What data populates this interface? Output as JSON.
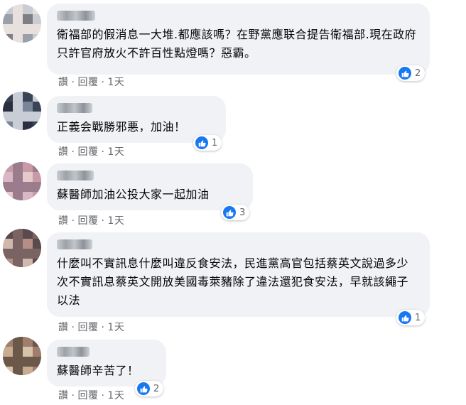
{
  "comments": [
    {
      "text": "衛福部的假消息一大堆.都應該嗎？在野黨應联合提告衛福部.現在政府只許官府放火不許百性點燈嗎？惡霸。",
      "like": "讚",
      "reply": "回覆",
      "time": "1天",
      "reactions": "2",
      "colors": [
        "#c9ccd2",
        "#7d7f85",
        "#e8e0dc",
        "#9aa0aa"
      ]
    },
    {
      "text": "正義会戰勝邪悪，加油！",
      "like": "讚",
      "reply": "回覆",
      "time": "1天",
      "reactions": "1",
      "colors": [
        "#3b4457",
        "#7b8598",
        "#c9cdd6",
        "#2b3040"
      ]
    },
    {
      "text": "蘇醫師加油公投大家一起加油",
      "like": "讚",
      "reply": "回覆",
      "time": "1天",
      "reactions": "3",
      "colors": [
        "#c79aa6",
        "#e6c9c9",
        "#9a7c8c",
        "#d9b7c4"
      ]
    },
    {
      "text": "什麼叫不實訊息什麼叫違反食安法，民進黨高官包括蔡英文說過多少次不實訊息蔡英文開放美國毒萊豬除了違法還犯食安法，早就該繩子以法",
      "like": "讚",
      "reply": "回覆",
      "time": "1天",
      "reactions": "1",
      "colors": [
        "#5a4a4d",
        "#b58e86",
        "#7a6463",
        "#d2b7ad"
      ]
    },
    {
      "text": "蘇醫師辛苦了！",
      "like": "讚",
      "reply": "回覆",
      "time": "1天",
      "reactions": "2",
      "colors": [
        "#a07e6c",
        "#d8c2aa",
        "#6b5848",
        "#c8ad92"
      ]
    }
  ],
  "accent": "#1877f2",
  "bubble_bg": "#f0f2f5",
  "meta_color": "#65676b"
}
